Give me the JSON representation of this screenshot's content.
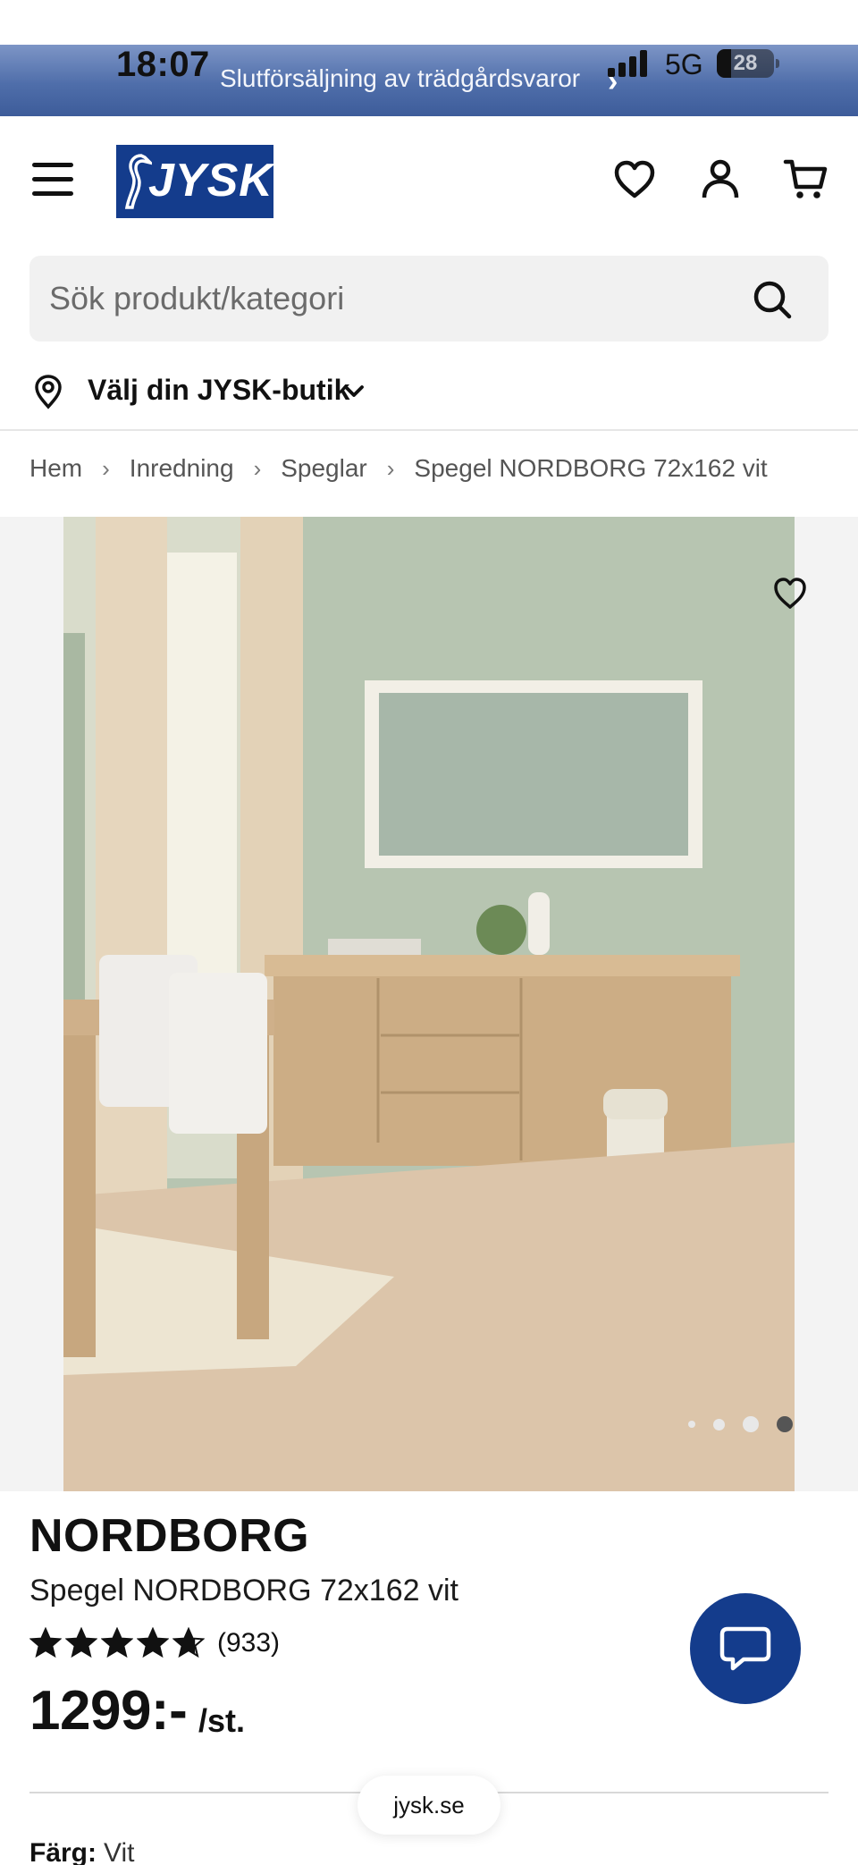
{
  "status_bar": {
    "time": "18:07",
    "network": "5G",
    "battery": "28",
    "promo_text": "Slutförsäljning av trädgårdsvaror",
    "promo_chevron": "›"
  },
  "header": {
    "logo_text": "JYSK",
    "brand_color": "#143c8c",
    "icons": [
      "menu-icon",
      "heart-icon",
      "user-icon",
      "cart-icon"
    ]
  },
  "search": {
    "placeholder": "Sök produkt/kategori"
  },
  "store": {
    "label": "Välj din JYSK-butik"
  },
  "breadcrumb": {
    "items": [
      "Hem",
      "Inredning",
      "Speglar"
    ],
    "current": "Spegel NORDBORG 72x162 vit",
    "separator": "›"
  },
  "gallery": {
    "image_count": 4,
    "active_index": 3
  },
  "product": {
    "brand": "NORDBORG",
    "name": "Spegel NORDBORG 72x162 vit",
    "rating": 4.7,
    "max_rating": 5,
    "review_count": "(933)",
    "price": "1299:-",
    "unit": "/st.",
    "color_label": "Färg:",
    "color_value": "Vit"
  },
  "browser": {
    "url": "jysk.se"
  }
}
